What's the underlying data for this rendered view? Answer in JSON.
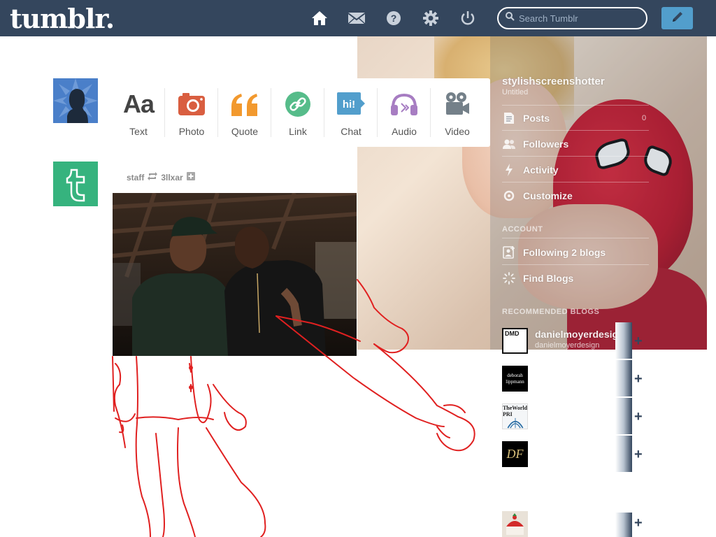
{
  "topbar": {
    "logo": "tumblr.",
    "nav": [
      {
        "name": "home-icon"
      },
      {
        "name": "mail-icon"
      },
      {
        "name": "help-icon"
      },
      {
        "name": "settings-gear-icon"
      },
      {
        "name": "power-icon"
      }
    ],
    "search_placeholder": "Search Tumblr",
    "compose_icon": "pencil-icon",
    "bar_color": "#34465d",
    "accent_color": "#529ecc"
  },
  "composer": {
    "types": [
      {
        "label": "Text",
        "icon": "Aa",
        "color": "#444444"
      },
      {
        "label": "Photo",
        "icon": "camera-icon",
        "color": "#d95e40"
      },
      {
        "label": "Quote",
        "icon": "quote-icon",
        "color": "#f2992e"
      },
      {
        "label": "Link",
        "icon": "link-icon",
        "color": "#56bc8a"
      },
      {
        "label": "Chat",
        "icon": "hi!",
        "color": "#529ecc"
      },
      {
        "label": "Audio",
        "icon": "headphones-icon",
        "color": "#a77dc2"
      },
      {
        "label": "Video",
        "icon": "video-camera-icon",
        "color": "#748089"
      }
    ]
  },
  "post": {
    "author": "staff",
    "reblogged_from": "3llxar",
    "follow_icon": "plus-square-icon"
  },
  "sidebar": {
    "blog_name": "stylishscreenshotter",
    "blog_sub": "Untitled",
    "items": [
      {
        "label": "Posts",
        "count": "0",
        "icon": "posts-icon"
      },
      {
        "label": "Followers",
        "count": "",
        "icon": "followers-icon"
      },
      {
        "label": "Activity",
        "count": "",
        "icon": "activity-icon"
      },
      {
        "label": "Customize",
        "count": "",
        "icon": "customize-icon"
      }
    ],
    "account_heading": "ACCOUNT",
    "account_items": [
      {
        "label": "Following 2 blogs",
        "icon": "following-icon"
      },
      {
        "label": "Find Blogs",
        "icon": "find-blogs-icon"
      }
    ],
    "recommended_heading": "RECOMMENDED BLOGS",
    "recommended": [
      {
        "name": "danielmoyerdesign",
        "sub": "danielmoyerdesign",
        "avatar_text": "DMD"
      },
      {
        "name": "",
        "sub": "",
        "avatar_text": "deborah lippmann"
      },
      {
        "name": "",
        "sub": "",
        "avatar_text": "TheWorld PRI"
      },
      {
        "name": "",
        "sub": "",
        "avatar_text": "DF"
      },
      {
        "name": "",
        "sub": "",
        "avatar_text": ""
      }
    ]
  }
}
